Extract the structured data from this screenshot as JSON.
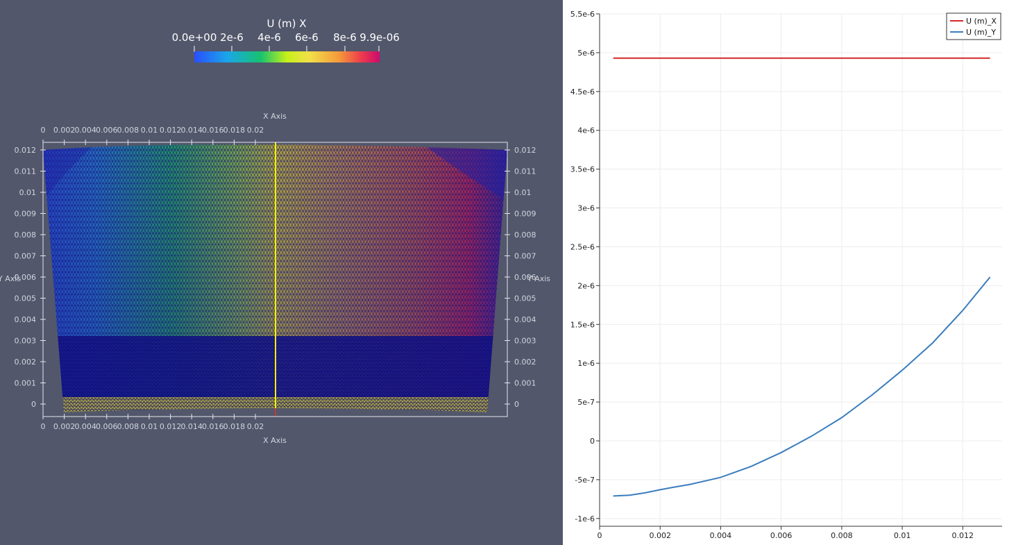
{
  "render_view": {
    "colorbar": {
      "title": "U (m) X",
      "tick_labels": [
        "0.0e+00",
        "2e-6",
        "4e-6",
        "6e-6",
        "8e-6",
        "9.9e-06"
      ]
    },
    "axes": {
      "x_title": "X Axis",
      "y_title": "Y Axis",
      "x_ticks": [
        "0",
        "0.002",
        "0.004",
        "0.006",
        "0.008",
        "0.01",
        "0.012",
        "0.014",
        "0.016",
        "0.018",
        "0.02"
      ],
      "y_ticks": [
        "0.012",
        "0.011",
        "0.01",
        "0.009",
        "0.008",
        "0.007",
        "0.006",
        "0.005",
        "0.004",
        "0.003",
        "0.002",
        "0.001",
        "0"
      ]
    },
    "colors": {
      "background": "#52576b",
      "mesh_edge": "#10107a",
      "slice_line": "#f4f000"
    }
  },
  "chart_data": {
    "type": "line",
    "title": "",
    "xlabel": "",
    "ylabel": "",
    "xlim": [
      0,
      0.0133
    ],
    "ylim": [
      -1.1e-06,
      5.5e-06
    ],
    "grid": true,
    "legend_position": "top-right",
    "x_tick_labels": [
      "0",
      "0.002",
      "0.004",
      "0.006",
      "0.008",
      "0.01",
      "0.012"
    ],
    "y_tick_labels": [
      "5.5e-6",
      "5e-6",
      "4.5e-6",
      "4e-6",
      "3.5e-6",
      "3e-6",
      "2.5e-6",
      "2e-6",
      "1.5e-6",
      "1e-6",
      "5e-7",
      "0",
      "-5e-7",
      "-1e-6"
    ],
    "x_ticks": [
      0,
      0.002,
      0.004,
      0.006,
      0.008,
      0.01,
      0.012
    ],
    "y_ticks": [
      5.5e-06,
      5e-06,
      4.5e-06,
      4e-06,
      3.5e-06,
      3e-06,
      2.5e-06,
      2e-06,
      1.5e-06,
      1e-06,
      5e-07,
      0,
      -5e-07,
      -1e-06
    ],
    "x": [
      0.00045,
      0.001,
      0.0015,
      0.002,
      0.0024,
      0.003,
      0.004,
      0.005,
      0.006,
      0.007,
      0.008,
      0.009,
      0.01,
      0.011,
      0.012,
      0.0129
    ],
    "series": [
      {
        "name": "U (m)_X",
        "color": "#d62728",
        "values": [
          4.93e-06,
          4.93e-06,
          4.93e-06,
          4.93e-06,
          4.93e-06,
          4.93e-06,
          4.93e-06,
          4.93e-06,
          4.93e-06,
          4.93e-06,
          4.93e-06,
          4.93e-06,
          4.93e-06,
          4.93e-06,
          4.93e-06,
          4.93e-06
        ]
      },
      {
        "name": "U (m)_Y",
        "color": "#3a7dbd",
        "values": [
          -7.1e-07,
          -7e-07,
          -6.7e-07,
          -6.3e-07,
          -6e-07,
          -5.6e-07,
          -4.7e-07,
          -3.3e-07,
          -1.5e-07,
          6e-08,
          3e-07,
          5.9e-07,
          9.1e-07,
          1.26e-06,
          1.68e-06,
          2.11e-06
        ]
      }
    ]
  }
}
